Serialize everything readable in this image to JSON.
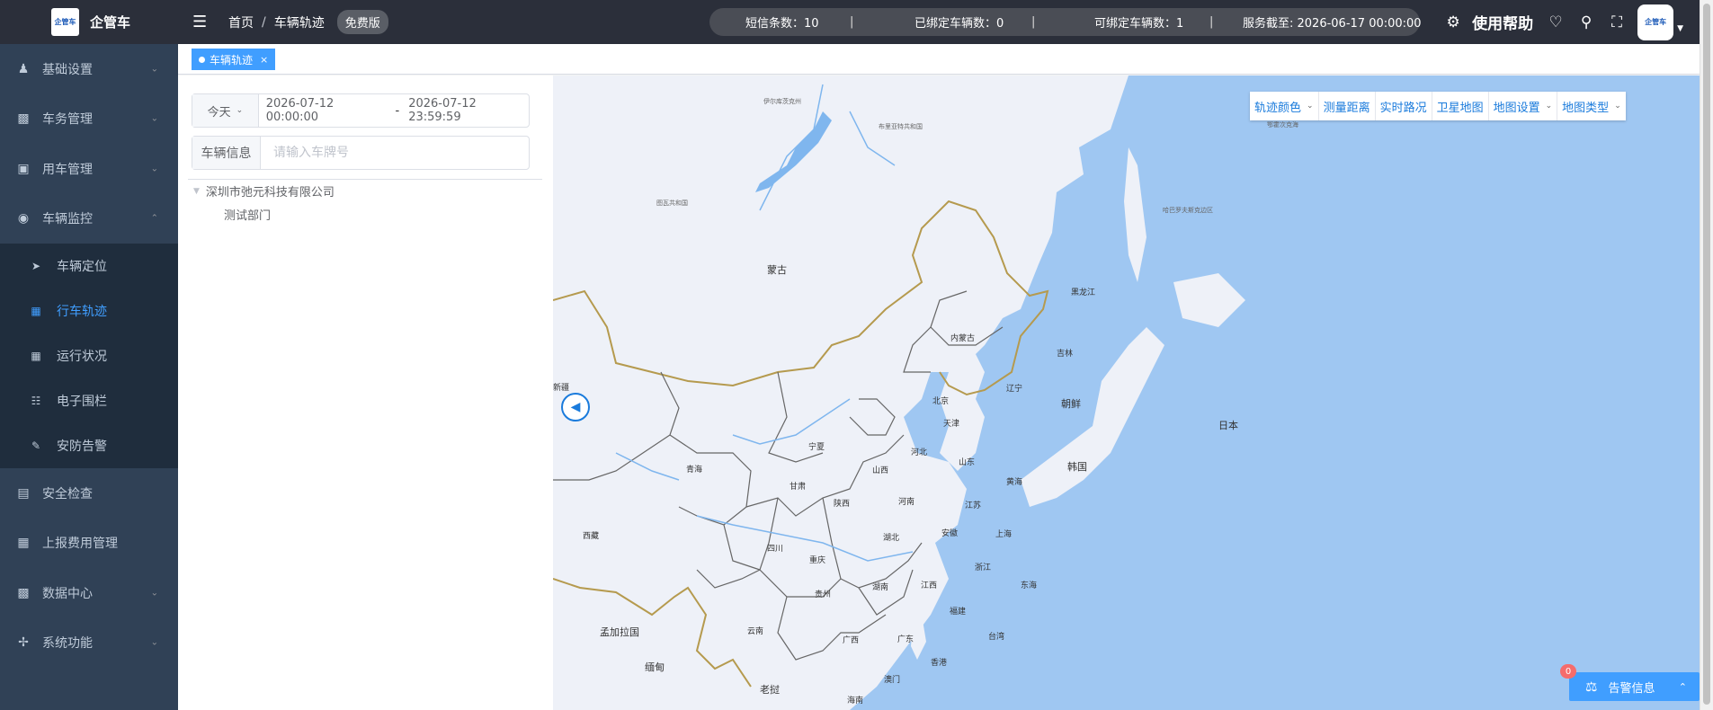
{
  "app": {
    "title": "企管车",
    "logo_text": "企管车"
  },
  "sidebar": {
    "items": [
      {
        "label": "基础设置",
        "icon": "user-settings-icon",
        "expanded": false
      },
      {
        "label": "车务管理",
        "icon": "monitor-icon",
        "expanded": false
      },
      {
        "label": "用车管理",
        "icon": "car-icon",
        "expanded": false
      },
      {
        "label": "车辆监控",
        "icon": "globe-icon",
        "expanded": true
      },
      {
        "label": "安全检查",
        "icon": "card-icon",
        "expanded": null
      },
      {
        "label": "上报费用管理",
        "icon": "grid-icon",
        "expanded": null
      },
      {
        "label": "数据中心",
        "icon": "lock-icon",
        "expanded": false
      },
      {
        "label": "系统功能",
        "icon": "cog-icon",
        "expanded": false
      }
    ],
    "subitems": [
      {
        "label": "车辆定位",
        "icon": "send-icon"
      },
      {
        "label": "行车轨迹",
        "icon": "route-icon",
        "active": true
      },
      {
        "label": "运行状况",
        "icon": "table-icon"
      },
      {
        "label": "电子围栏",
        "icon": "fence-icon"
      },
      {
        "label": "安防告警",
        "icon": "alert-icon"
      }
    ]
  },
  "navbar": {
    "breadcrumb": [
      "首页",
      "车辆轨迹"
    ],
    "free_badge": "免费版",
    "info": {
      "sms": "短信条数：10",
      "bound": "已绑定车辆数：0",
      "bindable": "可绑定车辆数：1",
      "service": "服务截至: 2026-06-17 00:00:00"
    },
    "help": "使用帮助"
  },
  "tags": {
    "active": "车辆轨迹",
    "close": "×"
  },
  "filter": {
    "range_label": "今天",
    "start": "2026-07-12 00:00:00",
    "separator": "-",
    "end": "2026-07-12 23:59:59",
    "vehicle_label": "车辆信息",
    "vehicle_placeholder": "请输入车牌号"
  },
  "tree": {
    "company": "深圳市弛元科技有限公司",
    "dept": "测试部门"
  },
  "map": {
    "toolbar": [
      "轨迹颜色",
      "测量距离",
      "实时路况",
      "卫星地图",
      "地图设置",
      "地图类型"
    ],
    "labels": {
      "mongolia": "蒙古",
      "neimenggu": "内蒙古",
      "heilongjiang": "黑龙江",
      "jilin": "吉林",
      "liaoning": "辽宁",
      "chaoxian": "朝鲜",
      "hanguo": "韩国",
      "riben": "日本",
      "xinjiang": "新疆",
      "qinghai": "青海",
      "xizang": "西藏",
      "gansu": "甘肃",
      "ningxia": "宁夏",
      "shanxi": "山西",
      "hebei": "河北",
      "beijing": "北京",
      "tianjin": "天津",
      "shandong": "山东",
      "shaanxi": "陕西",
      "henan": "河南",
      "jiangsu": "江苏",
      "shanghai": "上海",
      "anhui": "安徽",
      "hubei": "湖北",
      "sichuan": "四川",
      "chongqing": "重庆",
      "zhejiang": "浙江",
      "guizhou": "贵州",
      "hunan": "湖南",
      "jiangxi": "江西",
      "fujian": "福建",
      "yunnan": "云南",
      "guangxi": "广西",
      "guangdong": "广东",
      "taiwan": "台湾",
      "xianggang": "香港",
      "aomen": "澳门",
      "hainan": "海南",
      "huanghai": "黄海",
      "donghai": "东海",
      "mengjiala": "孟加拉国",
      "miandian": "缅甸",
      "laowo": "老挝",
      "irkutsk": "伊尔库茨克州",
      "buryatia": "布里亚特共和国",
      "tuva": "图瓦共和国",
      "khabarovsk": "哈巴罗夫斯克边区",
      "okhotsk": "鄂霍次克海"
    }
  },
  "alarm": {
    "label": "告警信息",
    "count": "0"
  }
}
